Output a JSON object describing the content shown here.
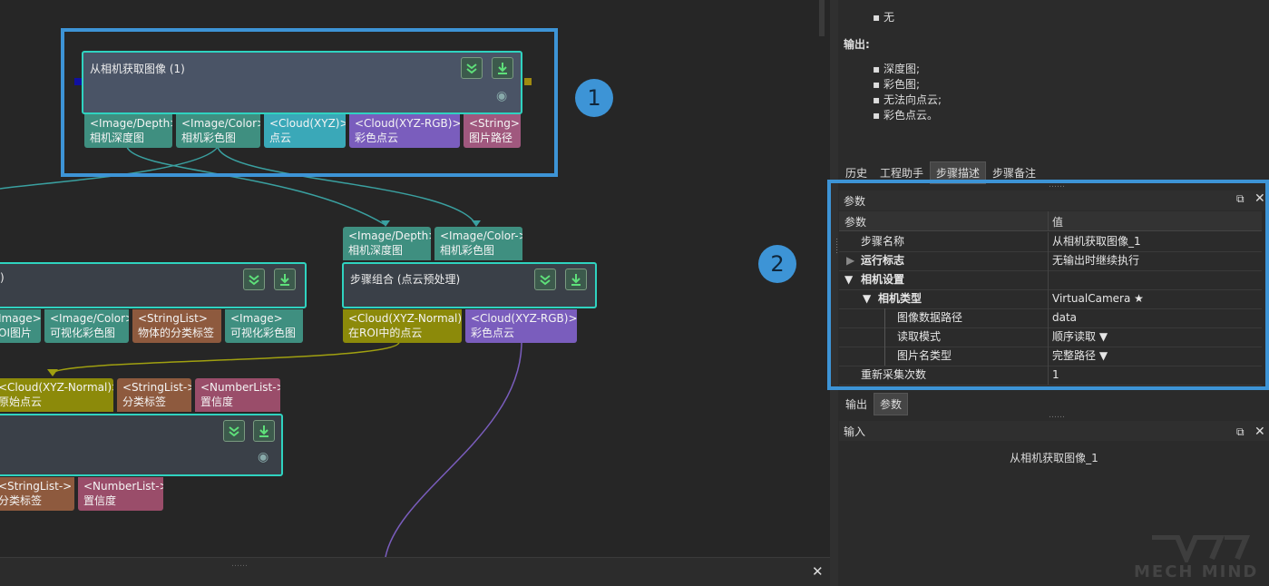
{
  "description_panel": {
    "prev_item": "无",
    "output_heading": "输出:",
    "outputs": [
      "深度图;",
      "彩色图;",
      "无法向点云;",
      "彩色点云。"
    ],
    "tabs": [
      "历史",
      "工程助手",
      "步骤描述",
      "步骤备注"
    ],
    "active_tab": "步骤描述"
  },
  "params_panel": {
    "title": "参数",
    "col_param": "参数",
    "col_value": "值",
    "rows": [
      {
        "key": "步骤名称",
        "value": "从相机获取图像_1"
      },
      {
        "key": "运行标志",
        "value": "无输出时继续执行"
      },
      {
        "key": "相机设置",
        "value": ""
      },
      {
        "key": "相机类型",
        "value": "VirtualCamera ★"
      },
      {
        "key": "图像数据路径",
        "value": "data"
      },
      {
        "key": "读取模式",
        "value": "顺序读取 ▼"
      },
      {
        "key": "图片名类型",
        "value": "完整路径 ▼"
      },
      {
        "key": "重新采集次数",
        "value": "1"
      }
    ],
    "bottom_tabs": [
      "输出",
      "参数"
    ]
  },
  "input_panel": {
    "title": "输入",
    "value": "从相机获取图像_1"
  },
  "watermark": "MECH MIND",
  "badges": [
    "1",
    "2"
  ],
  "canvas": {
    "node1": {
      "title": "从相机获取图像 (1)",
      "ports": [
        {
          "type": "<Image/Depth>",
          "name": "相机深度图"
        },
        {
          "type": "<Image/Color>",
          "name": "相机彩色图"
        },
        {
          "type": "<Cloud(XYZ)>",
          "name": "点云"
        },
        {
          "type": "<Cloud(XYZ-RGB)>",
          "name": "彩色点云"
        },
        {
          "type": "<String>",
          "name": "图片路径"
        }
      ]
    },
    "node2": {
      "title": "步骤组合 (点云预处理)",
      "inputs": [
        {
          "type": "<Image/Depth>",
          "name": "相机深度图"
        },
        {
          "type": "<Image/Color->",
          "name": "相机彩色图"
        }
      ],
      "ports": [
        {
          "type": "<Cloud(XYZ-Normal)>",
          "name": "在ROI中的点云"
        },
        {
          "type": "<Cloud(XYZ-RGB)>",
          "name": "彩色点云"
        }
      ]
    },
    "node3": {
      "title": ")",
      "ports": [
        {
          "type": "Image>",
          "name": "OI图片"
        },
        {
          "type": "<Image/Color>",
          "name": "可视化彩色图"
        },
        {
          "type": "<StringList>",
          "name": "物体的分类标签"
        },
        {
          "type": "<Image>",
          "name": "可视化彩色图"
        }
      ]
    },
    "node4": {
      "inputs": [
        {
          "type": "<Cloud(XYZ-Normal)>",
          "name": "原始点云"
        },
        {
          "type": "<StringList->",
          "name": "分类标签"
        },
        {
          "type": "<NumberList->",
          "name": "置信度"
        }
      ],
      "ports": [
        {
          "type": "<StringList->",
          "name": "分类标签"
        },
        {
          "type": "<NumberList->",
          "name": "置信度"
        }
      ]
    }
  }
}
